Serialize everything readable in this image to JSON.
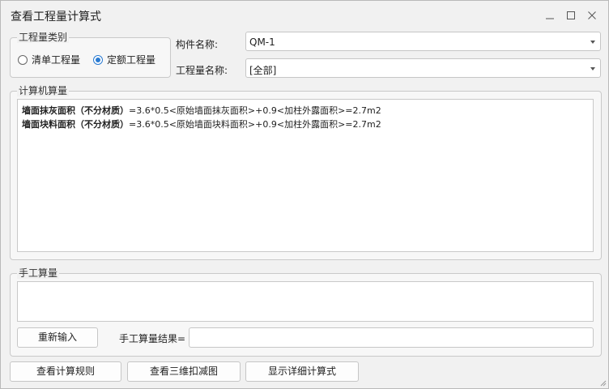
{
  "window": {
    "title": "查看工程量计算式"
  },
  "quantity_type": {
    "legend": "工程量类别",
    "options": [
      {
        "label": "清单工程量",
        "selected": false
      },
      {
        "label": "定额工程量",
        "selected": true
      }
    ]
  },
  "component": {
    "label": "构件名称:",
    "value": "QM-1"
  },
  "quantity_name": {
    "label": "工程量名称:",
    "value": "[全部]"
  },
  "computer_calc": {
    "legend": "计算机算量",
    "lines": [
      {
        "name": "墙面抹灰面积（不分材质）",
        "formula": "=3.6*0.5<原始墙面抹灰面积>+0.9<加柱外露面积>=2.7m2"
      },
      {
        "name": "墙面块料面积（不分材质）",
        "formula": "=3.6*0.5<原始墙面块料面积>+0.9<加柱外露面积>=2.7m2"
      }
    ]
  },
  "manual_calc": {
    "legend": "手工算量",
    "reenter_label": "重新输入",
    "result_label": "手工算量结果=",
    "result_value": ""
  },
  "buttons": {
    "view_rules": "查看计算规则",
    "view_3d": "查看三维扣减图",
    "show_detail": "显示详细计算式"
  }
}
